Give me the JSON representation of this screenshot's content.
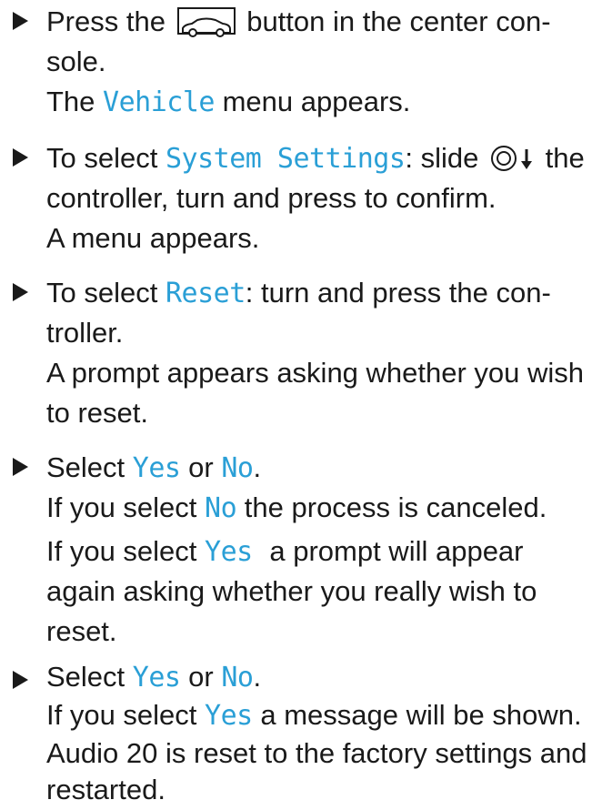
{
  "steps": [
    {
      "l1_pre": "Press the",
      "icon1": "car-button-icon",
      "l1_post": "button in the center con-",
      "l2": "sole.",
      "l3_pre": "The",
      "l3_hl": "Vehicle",
      "l3_post": "menu appears."
    },
    {
      "l1_pre": "To select",
      "l1_hl": "System Settings",
      "l1_mid": ": slide",
      "icon1": "controller-slide-down-icon",
      "l1_post": "the",
      "l2": "controller, turn and press to confirm.",
      "l3": "A menu appears."
    },
    {
      "l1_pre": "To select",
      "l1_hl": "Reset",
      "l1_post": ": turn and press the con-",
      "l2": "troller.",
      "l3": "A prompt appears asking whether you wish",
      "l4": "to reset."
    },
    {
      "l1_pre": "Select",
      "l1_hl1": "Yes",
      "l1_mid": "or",
      "l1_hl2": "No",
      "l1_post": ".",
      "l2_pre": "If you select",
      "l2_hl": "No",
      "l2_post": "the process is canceled.",
      "l3_pre": "If you select",
      "l3_hl": "Yes",
      "l3_post": "a prompt will appear",
      "l4": "again asking whether you really wish to",
      "l5": "reset."
    },
    {
      "l1_pre": "Select",
      "l1_hl1": "Yes",
      "l1_mid": "or",
      "l1_hl2": "No",
      "l1_post": ".",
      "l2_pre": "If you select",
      "l2_hl": "Yes",
      "l2_post": "a message will be shown.",
      "l3": "Audio 20 is reset to the factory settings and",
      "l4": "restarted."
    }
  ],
  "colors": {
    "text": "#1a1a1a",
    "highlight": "#2a9fd6"
  }
}
